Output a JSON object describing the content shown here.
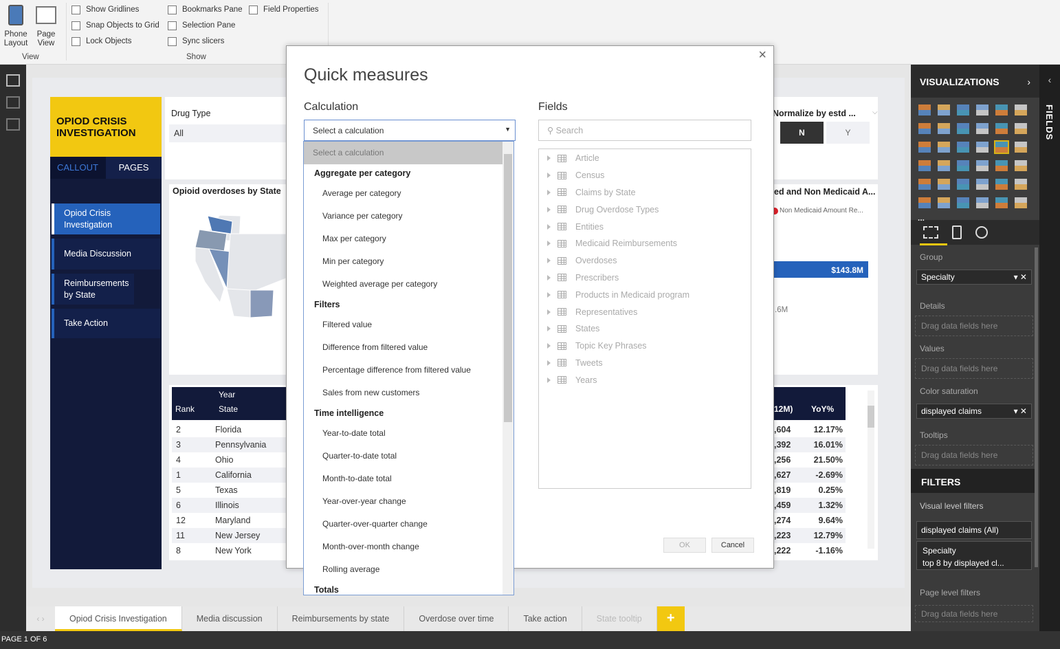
{
  "ribbon": {
    "phone_layout": "Phone Layout",
    "page_view": "Page View",
    "view_group": "View",
    "show_group": "Show",
    "checkboxes": [
      "Show Gridlines",
      "Snap Objects to Grid",
      "Lock Objects",
      "Bookmarks Pane",
      "Selection Pane",
      "Sync slicers",
      "Field Properties"
    ]
  },
  "report": {
    "title": "OPIOD CRISIS INVESTIGATION",
    "callout_tab": "CALLOUT",
    "pages_tab": "PAGES",
    "nav": [
      "Opiod Crisis Investigation",
      "Media Discussion",
      "Reimbursements by State",
      "Take Action"
    ],
    "drug_type_label": "Drug Type",
    "drug_type_value": "All",
    "map_title": "Opioid overdoses by State",
    "normalize_label": "Normalize by estd ...",
    "normalize_n": "N",
    "normalize_y": "Y",
    "bar_title": "ed and Non Medicaid A...",
    "bar_legend": "Non Medicaid Amount Re...",
    "bar_value": "$143.8M",
    "bar_value2": ".6M",
    "table": {
      "group_header": "Year",
      "col_rank": "Rank",
      "col_state": "State",
      "col_amount": "12M)",
      "col_yoy": "YoY%",
      "rows": [
        {
          "rank": "2",
          "state": "Florida",
          "amount": ",604",
          "yoy": "12.17%"
        },
        {
          "rank": "3",
          "state": "Pennsylvania",
          "amount": ",392",
          "yoy": "16.01%"
        },
        {
          "rank": "4",
          "state": "Ohio",
          "amount": ",256",
          "yoy": "21.50%"
        },
        {
          "rank": "1",
          "state": "California",
          "amount": ",627",
          "yoy": "-2.69%"
        },
        {
          "rank": "5",
          "state": "Texas",
          "amount": ",819",
          "yoy": "0.25%"
        },
        {
          "rank": "6",
          "state": "Illinois",
          "amount": ",459",
          "yoy": "1.32%"
        },
        {
          "rank": "12",
          "state": "Maryland",
          "amount": ",274",
          "yoy": "9.64%"
        },
        {
          "rank": "11",
          "state": "New Jersey",
          "amount": ",223",
          "yoy": "12.79%"
        },
        {
          "rank": "8",
          "state": "New York",
          "amount": ",222",
          "yoy": "-1.16%"
        }
      ]
    }
  },
  "dialog": {
    "title": "Quick measures",
    "calculation_label": "Calculation",
    "fields_label": "Fields",
    "select_value": "Select a calculation",
    "search_placeholder": "Search",
    "ok": "OK",
    "cancel": "Cancel",
    "list": [
      {
        "type": "selected",
        "label": "Select a calculation"
      },
      {
        "type": "header",
        "label": "Aggregate per category"
      },
      {
        "type": "opt",
        "label": "Average per category"
      },
      {
        "type": "opt",
        "label": "Variance per category"
      },
      {
        "type": "opt",
        "label": "Max per category"
      },
      {
        "type": "opt",
        "label": "Min per category"
      },
      {
        "type": "opt",
        "label": "Weighted average per category"
      },
      {
        "type": "header",
        "label": "Filters"
      },
      {
        "type": "opt",
        "label": "Filtered value"
      },
      {
        "type": "opt",
        "label": "Difference from filtered value"
      },
      {
        "type": "opt",
        "label": "Percentage difference from filtered value"
      },
      {
        "type": "opt",
        "label": "Sales from new customers"
      },
      {
        "type": "header",
        "label": "Time intelligence"
      },
      {
        "type": "opt",
        "label": "Year-to-date total"
      },
      {
        "type": "opt",
        "label": "Quarter-to-date total"
      },
      {
        "type": "opt",
        "label": "Month-to-date total"
      },
      {
        "type": "opt",
        "label": "Year-over-year change"
      },
      {
        "type": "opt",
        "label": "Quarter-over-quarter change"
      },
      {
        "type": "opt",
        "label": "Month-over-month change"
      },
      {
        "type": "opt",
        "label": "Rolling average"
      },
      {
        "type": "header",
        "label": "Totals"
      }
    ],
    "fields": [
      "Article",
      "Census",
      "Claims by State",
      "Drug Overdose Types",
      "Entities",
      "Medicaid Reimbursements",
      "Overdoses",
      "Prescribers",
      "Products in Medicaid program",
      "Representatives",
      "States",
      "Topic Key Phrases",
      "Tweets",
      "Years"
    ]
  },
  "viz": {
    "title": "VISUALIZATIONS",
    "fields_tab": "FIELDS",
    "more": "...",
    "group_label": "Group",
    "group_value": "Specialty",
    "details_label": "Details",
    "values_label": "Values",
    "color_label": "Color saturation",
    "color_value": "displayed claims",
    "tooltips_label": "Tooltips",
    "drag": "Drag data fields here",
    "filters_title": "FILTERS",
    "visual_filters": "Visual level filters",
    "filter1": "displayed claims  (All)",
    "filter2_name": "Specialty",
    "filter2_desc": "top 8 by displayed cl...",
    "page_filters": "Page level filters"
  },
  "tabs": [
    "Opiod Crisis Investigation",
    "Media discussion",
    "Reimbursements by state",
    "Overdose over time",
    "Take action",
    "State tooltip"
  ],
  "status": "PAGE 1 OF 6",
  "colors": {
    "accent_yellow": "#f2c811",
    "navy": "#121a3a",
    "blue": "#2562bb"
  }
}
